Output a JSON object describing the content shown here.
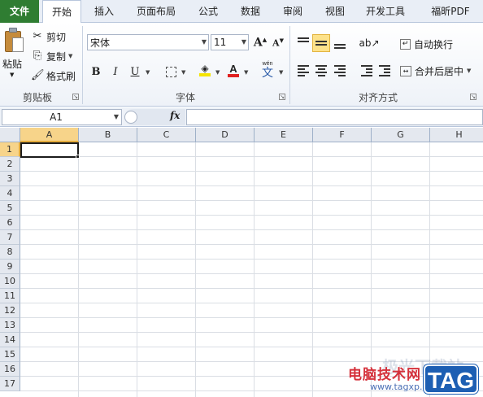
{
  "tabs": [
    "文件",
    "开始",
    "插入",
    "页面布局",
    "公式",
    "数据",
    "审阅",
    "视图",
    "开发工具",
    "福昕PDF"
  ],
  "clipboard": {
    "paste": "粘贴",
    "cut": "剪切",
    "copy": "复制",
    "format_painter": "格式刷",
    "group_label": "剪贴板"
  },
  "font": {
    "font_name": "宋体",
    "font_size": "11",
    "bold": "B",
    "italic": "I",
    "underline": "U",
    "font_color_letter": "A",
    "highlight_color": "#f5e400",
    "font_color": "#e02020",
    "phonetic": "wén",
    "phonetic_char": "文",
    "group_label": "字体"
  },
  "alignment": {
    "wrap_text": "自动换行",
    "merge_center": "合并后居中",
    "group_label": "对齐方式"
  },
  "formula_bar": {
    "name_box": "A1",
    "fx": "fx",
    "formula": ""
  },
  "sheet": {
    "columns": [
      "A",
      "B",
      "C",
      "D",
      "E",
      "F",
      "G",
      "H"
    ],
    "rows": [
      "1",
      "2",
      "3",
      "4",
      "5",
      "6",
      "7",
      "8",
      "9",
      "10",
      "11",
      "12",
      "13",
      "14",
      "15",
      "16",
      "17"
    ],
    "selected_cell": "A1"
  },
  "watermark": {
    "site_name": "电脑技术网",
    "url": "www.tagxp.com",
    "logo": "TAG",
    "ghost_text": "极光下载站"
  }
}
